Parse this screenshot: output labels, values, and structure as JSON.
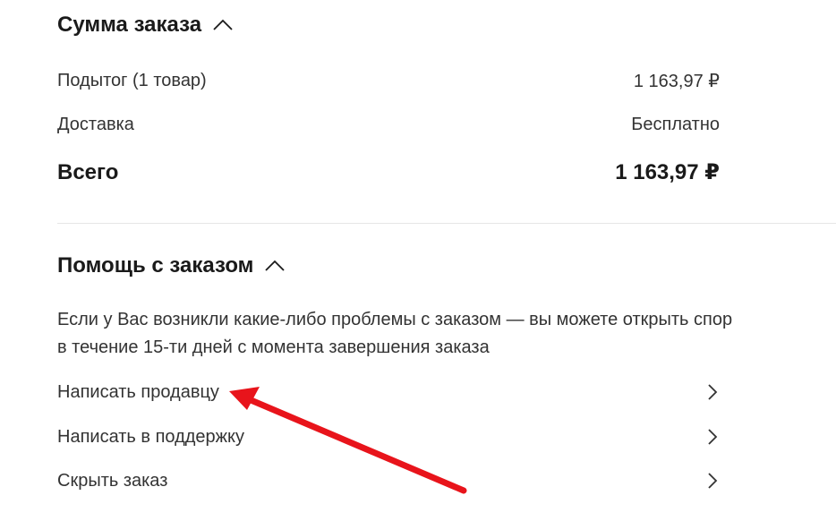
{
  "order_summary": {
    "title": "Сумма заказа",
    "subtotal_label": "Подытог (1 товар)",
    "subtotal_value": "1 163,97 ₽",
    "delivery_label": "Доставка",
    "delivery_value": "Бесплатно",
    "total_label": "Всего",
    "total_value": "1 163,97 ₽"
  },
  "order_help": {
    "title": "Помощь с заказом",
    "description": "Если у Вас возникли какие-либо проблемы с заказом — вы можете открыть спор в течение 15-ти дней с момента завершения заказа",
    "links": [
      {
        "label": "Написать продавцу"
      },
      {
        "label": "Написать в поддержку"
      },
      {
        "label": "Скрыть заказ"
      }
    ]
  },
  "icons": {
    "collapse": "chevron-up-icon",
    "link": "chevron-right-icon"
  },
  "annotation": {
    "arrow_color": "#e8141b"
  }
}
